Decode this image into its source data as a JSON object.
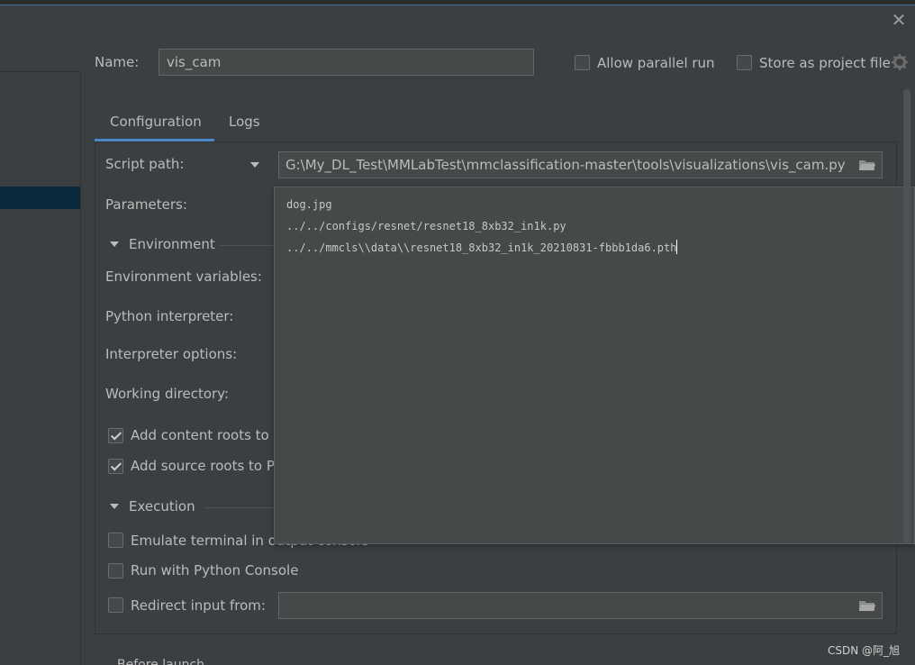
{
  "window": {
    "close_glyph": "✕"
  },
  "name_field": {
    "label": "Name:",
    "value": "vis_cam"
  },
  "options": {
    "allow_parallel_run": {
      "label": "Allow parallel run",
      "checked": false
    },
    "store_as_project_file": {
      "label": "Store as project file",
      "checked": false
    }
  },
  "tabs": [
    {
      "label": "Configuration",
      "active": true
    },
    {
      "label": "Logs",
      "active": false
    }
  ],
  "script_path": {
    "label": "Script path:",
    "value": "G:\\My_DL_Test\\MMLabTest\\mmclassification-master\\tools\\visualizations\\vis_cam.py"
  },
  "parameters": {
    "label": "Parameters:",
    "lines": [
      "dog.jpg",
      "../../configs/resnet/resnet18_8xb32_in1k.py",
      "../../mmcls\\\\data\\\\resnet18_8xb32_in1k_20210831-fbbb1da6.pth"
    ]
  },
  "environment": {
    "header": "Environment",
    "env_vars_label": "Environment variables:",
    "python_interpreter_label": "Python interpreter:",
    "interpreter_options_label": "Interpreter options:",
    "working_directory_label": "Working directory:",
    "add_content_roots": {
      "label": "Add content roots to",
      "checked": true
    },
    "add_source_roots": {
      "label": "Add source roots to P",
      "checked": true
    }
  },
  "execution": {
    "header": "Execution",
    "emulate_terminal": {
      "label": "Emulate terminal in output console",
      "checked": false
    },
    "run_with_console": {
      "label": "Run with Python Console",
      "checked": false
    },
    "redirect_input": {
      "label": "Redirect input from:",
      "checked": false,
      "value": ""
    }
  },
  "bottom": {
    "partial_text": "Before launch"
  },
  "watermark": "CSDN @阿_旭",
  "icons": {
    "close": "close-icon",
    "gear": "gear-icon",
    "folder": "folder-icon",
    "dropdown": "chevron-down-icon",
    "collapse": "collapse-triangle-icon"
  },
  "colors": {
    "background": "#3c3f41",
    "input_background": "#45494a",
    "accent": "#4a88c7",
    "selection": "#0d293e",
    "text": "#bbbbbb"
  }
}
